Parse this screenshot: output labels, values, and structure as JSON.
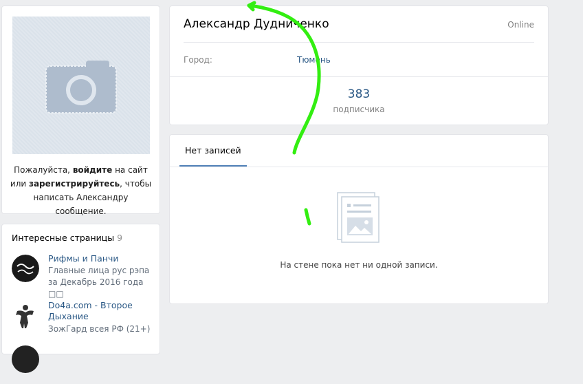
{
  "photo_card": {
    "login_prefix": "Пожалуйста, ",
    "login_link": "войдите",
    "login_middle": " на сайт или ",
    "register_link": "зарегистрируйтесь",
    "login_suffix": ", чтобы написать Александру сообщение."
  },
  "interesting_pages": {
    "title": "Интересные страницы",
    "count": "9",
    "items": [
      {
        "name": "Рифмы и Панчи",
        "description": "Главные лица рус рэпа за Декабрь 2016 года □□"
      },
      {
        "name": "Do4a.com - Второе Дыхание",
        "description": "ЗожГард всея РФ (21+)"
      }
    ]
  },
  "profile": {
    "name": "Александр Дудниченко",
    "status": "Online",
    "city_label": "Город:",
    "city_value": "Тюмень",
    "followers_count": "383",
    "followers_label": "подписчика"
  },
  "wall": {
    "tab_label": "Нет записей",
    "empty_text": "На стене пока нет ни одной записи."
  },
  "colors": {
    "background": "#edeef0",
    "link": "#2a5885",
    "accent": "#5181b8",
    "scribble": "#33ee11"
  }
}
